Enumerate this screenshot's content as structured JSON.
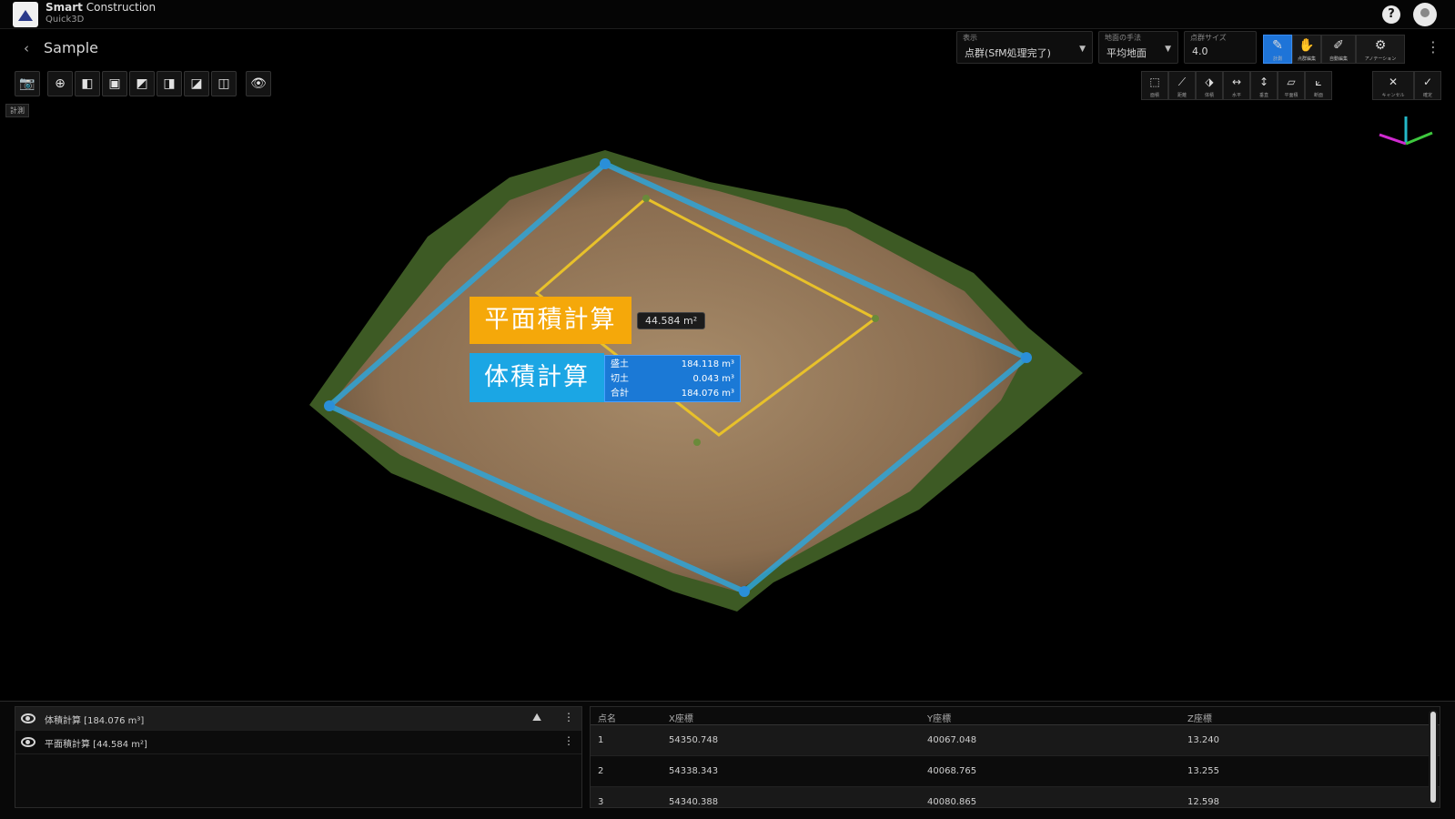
{
  "app": {
    "name_bold": "Smart",
    "name_rest": " Construction",
    "product": "Quick3D"
  },
  "header": {
    "help": "?",
    "title": "Sample",
    "display_select": {
      "label": "表示",
      "value": "点群(SfM処理完了)"
    },
    "method_select": {
      "label": "地面の手法",
      "value": "平均地面"
    },
    "size_input": {
      "label": "点群サイズ",
      "value": "4.0"
    },
    "tools": [
      {
        "cap": "計測",
        "glyph": "✎"
      },
      {
        "cap": "点群編集",
        "glyph": "✋"
      },
      {
        "cap": "自動編集",
        "glyph": "✐"
      },
      {
        "cap": "アノテーション",
        "glyph": "⚙"
      }
    ]
  },
  "left_toolbar": {
    "buttons": [
      "📷",
      "⊕",
      "◧",
      "▣",
      "◩",
      "◨",
      "◪",
      "◫",
      "👁"
    ],
    "label": "計測"
  },
  "measure_tools": {
    "buttons": [
      {
        "cap": "面積",
        "glyph": "⬚"
      },
      {
        "cap": "距離",
        "glyph": "⟋"
      },
      {
        "cap": "体積",
        "glyph": "⬗"
      },
      {
        "cap": "水平",
        "glyph": "↔"
      },
      {
        "cap": "垂直",
        "glyph": "↕"
      },
      {
        "cap": "平面積",
        "glyph": "▱"
      },
      {
        "cap": "断面",
        "glyph": "⟀"
      }
    ],
    "actions": [
      {
        "cap": "キャンセル",
        "glyph": "✕"
      },
      {
        "cap": "確定",
        "glyph": "✓"
      }
    ]
  },
  "viewport": {
    "label_area": "平面積計算",
    "area_value": "44.584 m²",
    "label_volume": "体積計算",
    "volume_rows": [
      {
        "k": "盛土",
        "v": "184.118 m³"
      },
      {
        "k": "切土",
        "v": "0.043 m³"
      },
      {
        "k": "合計",
        "v": "184.076 m³"
      }
    ]
  },
  "layers": [
    {
      "name": "体積計算 [184.076 m³]",
      "action": "⛰",
      "menu": "⋮"
    },
    {
      "name": "平面積計算 [44.584 m²]",
      "action": "",
      "menu": "⋮"
    }
  ],
  "coords_table": {
    "headers": [
      "点名",
      "X座標",
      "Y座標",
      "Z座標"
    ],
    "rows": [
      [
        "1",
        "54350.748",
        "40067.048",
        "13.240"
      ],
      [
        "2",
        "54338.343",
        "40068.765",
        "13.255"
      ],
      [
        "3",
        "54340.388",
        "40080.865",
        "12.598"
      ]
    ]
  },
  "colors": {
    "accent_blue": "#1e74d8",
    "area_orange": "#f5a80a",
    "volume_cyan": "#1ba6e4"
  }
}
